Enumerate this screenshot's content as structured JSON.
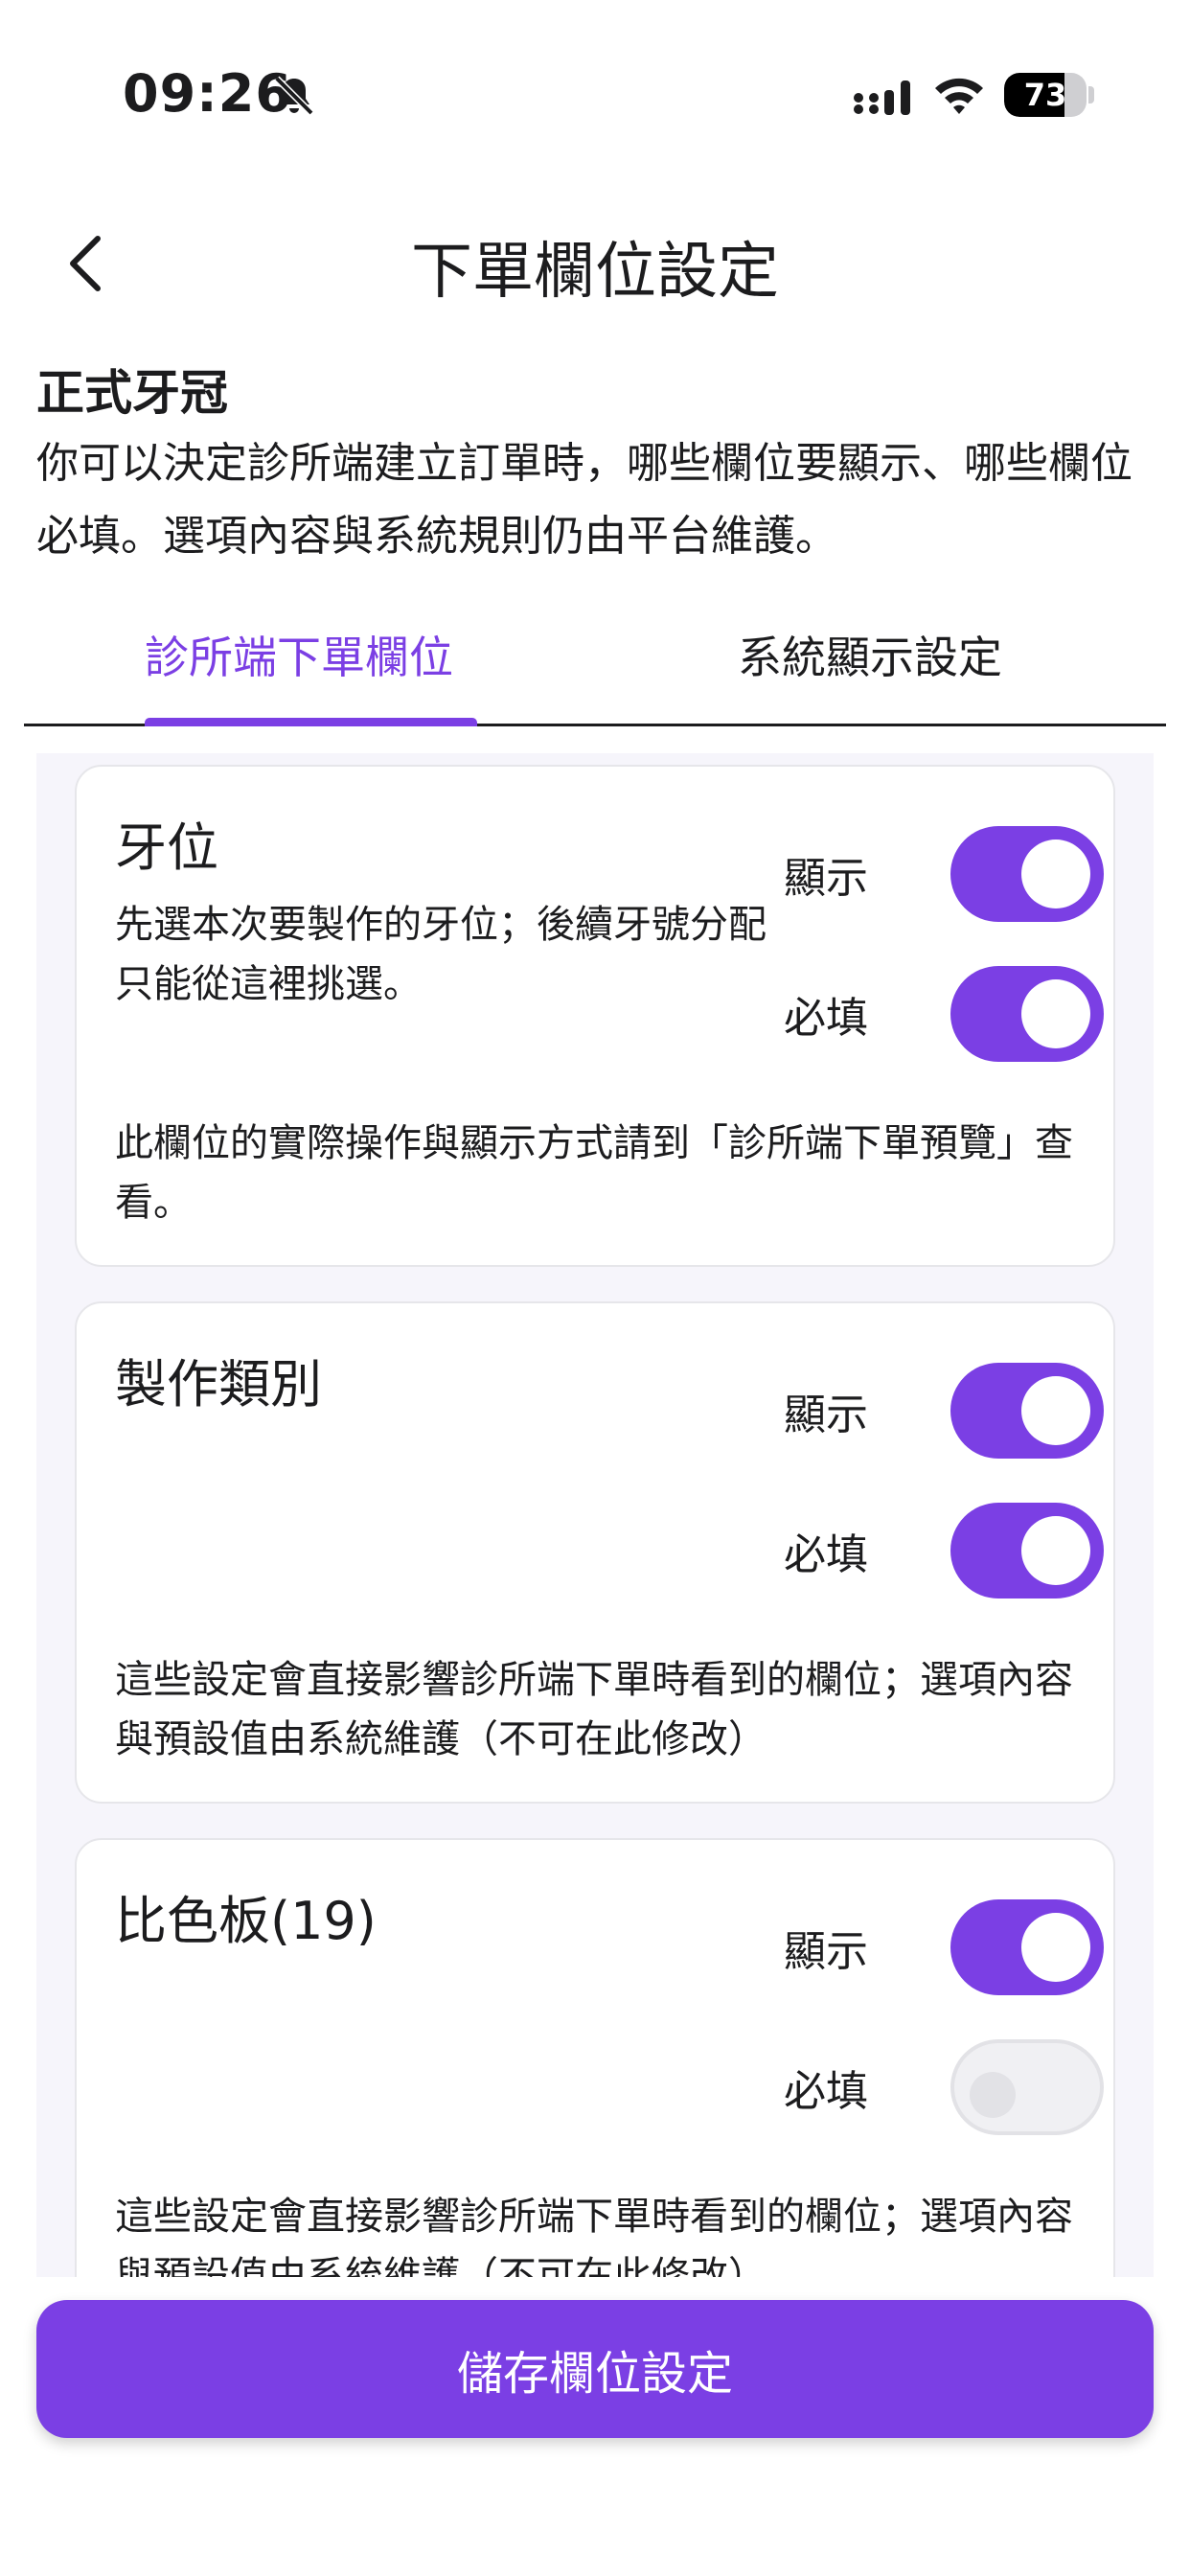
{
  "status_bar": {
    "time": "09:26",
    "battery_level": "73",
    "battery_percent": 73
  },
  "header": {
    "title": "下單欄位設定",
    "back_icon": "chevron-left-icon"
  },
  "section": {
    "title": "正式牙冠",
    "description": "你可以決定診所端建立訂單時，哪些欄位要顯示、哪些欄位必填。選項內容與系統規則仍由平台維護。"
  },
  "tabs": [
    {
      "label": "診所端下單欄位",
      "active": true
    },
    {
      "label": "系統顯示設定",
      "active": false
    }
  ],
  "cards": [
    {
      "title": "牙位",
      "description": "先選本次要製作的牙位；後續牙號分配只能從這裡挑選。",
      "show_label": "顯示",
      "show_on": true,
      "required_label": "必填",
      "required_on": true,
      "note": "此欄位的實際操作與顯示方式請到「診所端下單預覽」查看。"
    },
    {
      "title": "製作類別",
      "description": "",
      "show_label": "顯示",
      "show_on": true,
      "required_label": "必填",
      "required_on": true,
      "note": "這些設定會直接影響診所端下單時看到的欄位；選項內容與預設值由系統維護（不可在此修改）"
    },
    {
      "title": "比色板(19)",
      "description": "",
      "show_label": "顯示",
      "show_on": true,
      "required_label": "必填",
      "required_on": false,
      "note": "這些設定會直接影響診所端下單時看到的欄位；選項內容與預設值由系統維護（不可在此修改）"
    }
  ],
  "save_button": {
    "label": "儲存欄位設定"
  },
  "colors": {
    "accent": "#7b3fe4",
    "toggle_off": "#f0f0f3",
    "background": "#ffffff",
    "scroll_background": "#f6f5fb"
  }
}
